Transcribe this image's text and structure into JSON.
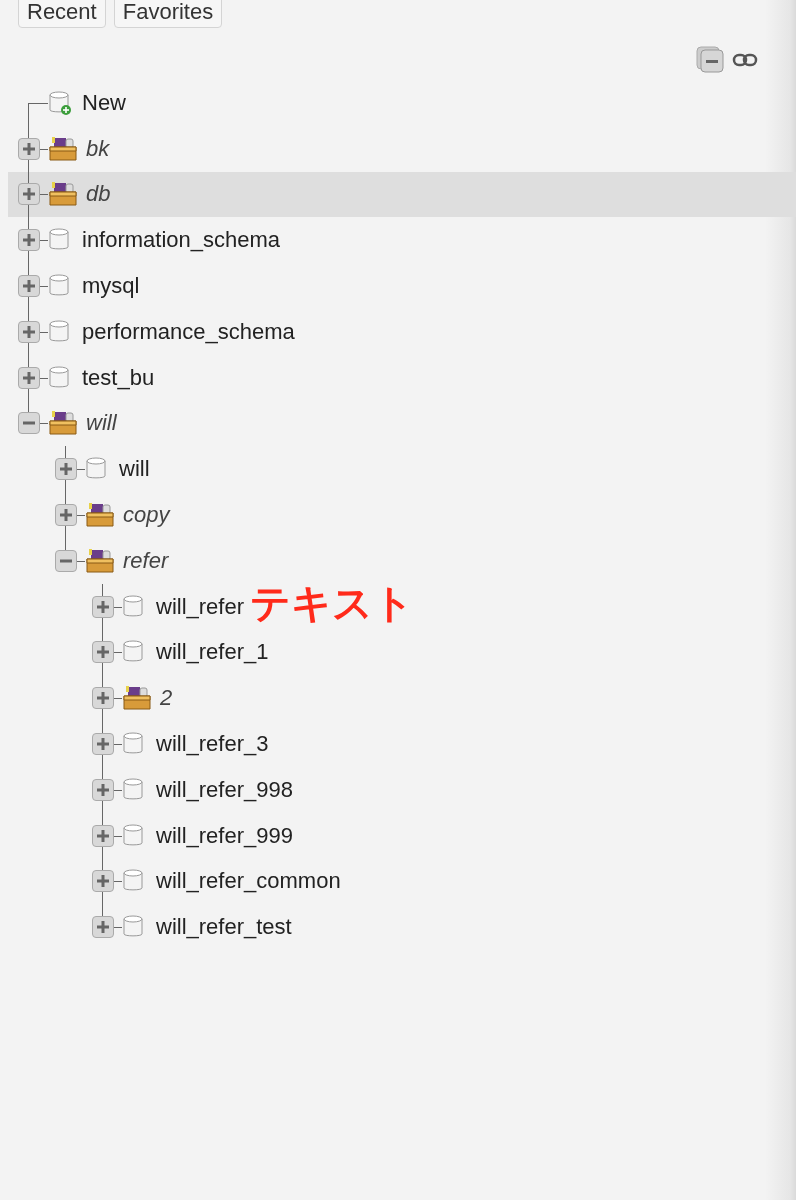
{
  "top_tabs": [
    {
      "label": "Recent"
    },
    {
      "label": "Favorites"
    }
  ],
  "tree": [
    {
      "kind": "new",
      "label": "New"
    },
    {
      "kind": "group",
      "label": "bk",
      "expanded": false,
      "selected": false
    },
    {
      "kind": "group",
      "label": "db",
      "expanded": false,
      "selected": true
    },
    {
      "kind": "database",
      "label": "information_schema",
      "expanded": false,
      "selected": false
    },
    {
      "kind": "database",
      "label": "mysql",
      "expanded": false,
      "selected": false
    },
    {
      "kind": "database",
      "label": "performance_schema",
      "expanded": false,
      "selected": false
    },
    {
      "kind": "database",
      "label": "test_bu",
      "expanded": false,
      "selected": false
    },
    {
      "kind": "group",
      "label": "will",
      "expanded": true,
      "selected": false,
      "children": [
        {
          "kind": "database",
          "label": "will",
          "expanded": false,
          "selected": false
        },
        {
          "kind": "group",
          "label": "copy",
          "expanded": false,
          "selected": false
        },
        {
          "kind": "group",
          "label": "refer",
          "expanded": true,
          "selected": false,
          "children": [
            {
              "kind": "database",
              "label": "will_refer",
              "expanded": false,
              "selected": false,
              "annotation": "テキスト"
            },
            {
              "kind": "database",
              "label": "will_refer_1",
              "expanded": false,
              "selected": false
            },
            {
              "kind": "group",
              "label": "2",
              "expanded": false,
              "selected": false
            },
            {
              "kind": "database",
              "label": "will_refer_3",
              "expanded": false,
              "selected": false
            },
            {
              "kind": "database",
              "label": "will_refer_998",
              "expanded": false,
              "selected": false
            },
            {
              "kind": "database",
              "label": "will_refer_999",
              "expanded": false,
              "selected": false
            },
            {
              "kind": "database",
              "label": "will_refer_common",
              "expanded": false,
              "selected": false
            },
            {
              "kind": "database",
              "label": "will_refer_test",
              "expanded": false,
              "selected": false
            }
          ]
        }
      ]
    }
  ]
}
